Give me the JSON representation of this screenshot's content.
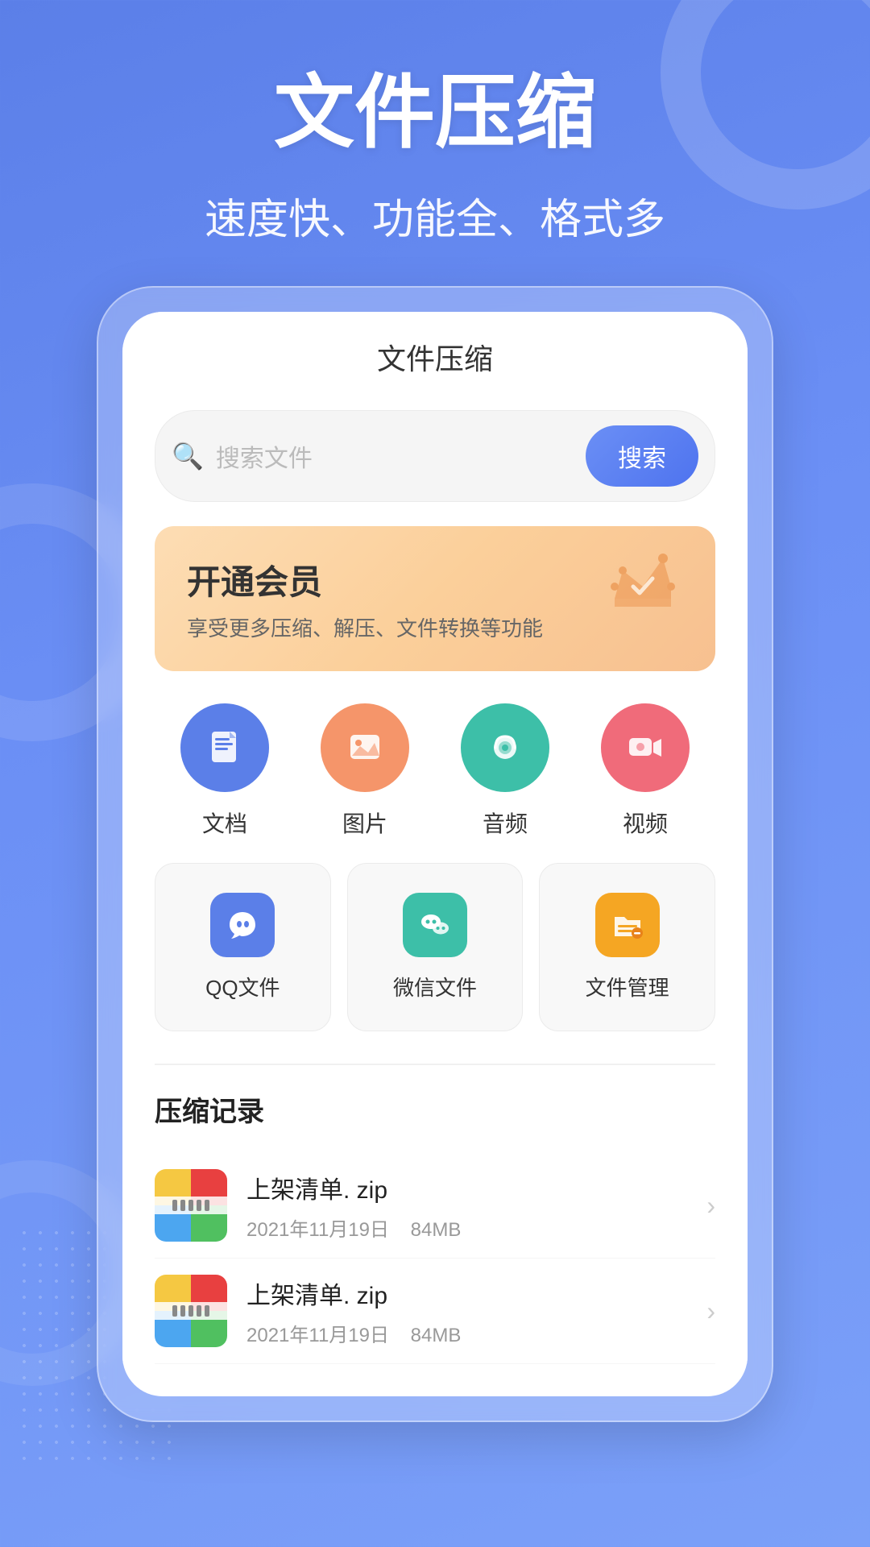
{
  "app": {
    "title": "文件压缩",
    "hero_title": "文件压缩",
    "hero_subtitle": "速度快、功能全、格式多"
  },
  "phone": {
    "title": "文件压缩"
  },
  "search": {
    "placeholder": "搜索文件",
    "button_label": "搜索"
  },
  "vip": {
    "title": "开通会员",
    "description": "享受更多压缩、解压、文件转换等功能"
  },
  "categories": [
    {
      "id": "doc",
      "label": "文档",
      "color": "cat-blue",
      "icon": "📄"
    },
    {
      "id": "image",
      "label": "图片",
      "color": "cat-orange",
      "icon": "🖼"
    },
    {
      "id": "audio",
      "label": "音频",
      "color": "cat-teal",
      "icon": "🎵"
    },
    {
      "id": "video",
      "label": "视频",
      "color": "cat-pink",
      "icon": "🎬"
    }
  ],
  "tools": [
    {
      "id": "qq",
      "label": "QQ文件",
      "color": "tool-blue",
      "icon": "🐧"
    },
    {
      "id": "wechat",
      "label": "微信文件",
      "color": "tool-teal",
      "icon": "💬"
    },
    {
      "id": "files",
      "label": "文件管理",
      "color": "tool-yellow",
      "icon": "📁"
    }
  ],
  "records": {
    "section_title": "压缩记录",
    "items": [
      {
        "id": "rec1",
        "name": "上架清单. zip",
        "date": "2021年11月19日",
        "size": "84MB"
      },
      {
        "id": "rec2",
        "name": "上架清单. zip",
        "date": "2021年11月19日",
        "size": "84MB"
      }
    ]
  },
  "icons": {
    "search": "🔍",
    "arrow_right": "›",
    "crown": "👑"
  }
}
